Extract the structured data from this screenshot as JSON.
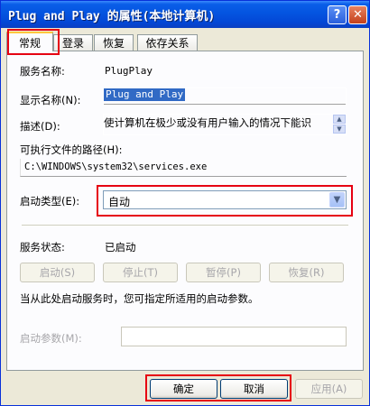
{
  "window": {
    "title": "Plug and Play 的属性(本地计算机)",
    "help_glyph": "?",
    "close_glyph": "✕"
  },
  "tabs": [
    "常规",
    "登录",
    "恢复",
    "依存关系"
  ],
  "general": {
    "service_name_label": "服务名称:",
    "service_name_value": "PlugPlay",
    "display_name_label": "显示名称(N):",
    "display_name_value": "Plug and Play",
    "description_label": "描述(D):",
    "description_value": "使计算机在极少或没有用户输入的情况下能识",
    "exe_path_label": "可执行文件的路径(H):",
    "exe_path_value": "C:\\WINDOWS\\system32\\services.exe",
    "startup_type_label": "启动类型(E):",
    "startup_type_value": "自动",
    "status_label": "服务状态:",
    "status_value": "已启动",
    "start_btn": "启动(S)",
    "stop_btn": "停止(T)",
    "pause_btn": "暂停(P)",
    "resume_btn": "恢复(R)",
    "hint_text": "当从此处启动服务时，您可指定所适用的启动参数。",
    "params_label": "启动参数(M):",
    "params_value": ""
  },
  "footer": {
    "ok": "确定",
    "cancel": "取消",
    "apply": "应用(A)"
  },
  "colors": {
    "titlebar": "#0454e0",
    "highlight": "#e60012",
    "selection": "#316ac5"
  }
}
